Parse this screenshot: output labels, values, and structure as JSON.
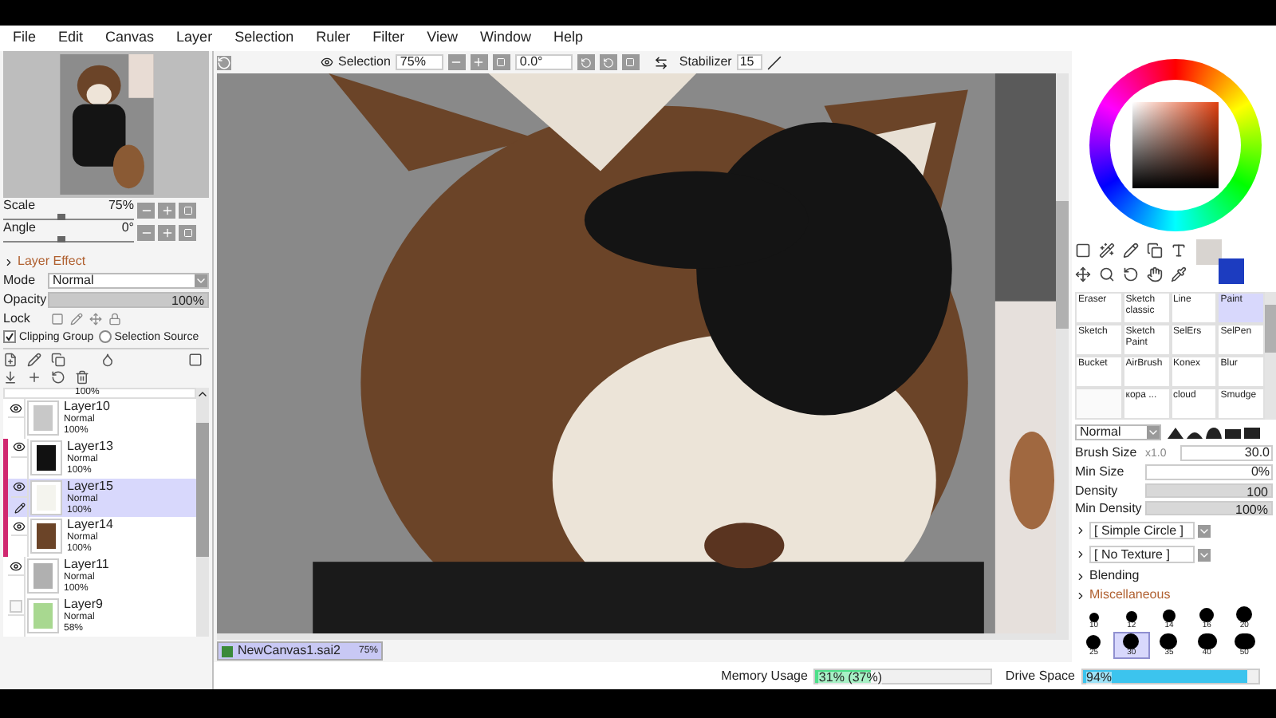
{
  "menu": [
    "File",
    "Edit",
    "Canvas",
    "Layer",
    "Selection",
    "Ruler",
    "Filter",
    "View",
    "Window",
    "Help"
  ],
  "navigator": {
    "scale": {
      "label": "Scale",
      "value": "75%",
      "level": 0.42
    },
    "angle": {
      "label": "Angle",
      "value": "0°",
      "level": 0.42
    }
  },
  "layer_panel": {
    "header": "Layer Effect",
    "mode_label": "Mode",
    "mode": "Normal",
    "opacity": {
      "label": "Opacity",
      "value": "100%",
      "level": 1
    },
    "lock_label": "Lock",
    "clipping_group": {
      "label": "Clipping Group",
      "checked": true
    },
    "selection_source": {
      "label": "Selection Source",
      "selected": false
    },
    "layers": [
      {
        "kind": "partial",
        "opacity": "100%"
      },
      {
        "kind": "layer",
        "name": "Layer10",
        "mode": "Normal",
        "opacity": "100%",
        "visible": true,
        "clipped": false,
        "selected": false,
        "color": "#c8c8c8"
      },
      {
        "kind": "layer",
        "name": "Layer13",
        "mode": "Normal",
        "opacity": "100%",
        "visible": true,
        "clipped": true,
        "selected": false,
        "color": "#111111"
      },
      {
        "kind": "layer",
        "name": "Layer15",
        "mode": "Normal",
        "opacity": "100%",
        "visible": true,
        "clipped": true,
        "selected": true,
        "color": "#f4f4ee"
      },
      {
        "kind": "layer",
        "name": "Layer14",
        "mode": "Normal",
        "opacity": "100%",
        "visible": true,
        "clipped": true,
        "selected": false,
        "color": "#6b4428"
      },
      {
        "kind": "layer",
        "name": "Layer11",
        "mode": "Normal",
        "opacity": "100%",
        "visible": true,
        "clipped": false,
        "selected": false,
        "color": "#b0b0b0"
      },
      {
        "kind": "layer",
        "name": "Layer9",
        "mode": "Normal",
        "opacity": "58%",
        "visible": false,
        "clipped": false,
        "selected": false,
        "color": "#a8d890"
      }
    ]
  },
  "toolbar": {
    "selection_label": "Selection",
    "zoom": "75%",
    "angle": "0.0°",
    "stabilizer_label": "Stabilizer",
    "stabilizer": "15"
  },
  "canvas_tab": {
    "name": "NewCanvas1.sai2",
    "zoom": "75%",
    "selected": true
  },
  "status": [
    {
      "label": "Memory Usage",
      "value": "31% (37%)",
      "level": 0.31,
      "color": "#4ee08a"
    },
    {
      "label": "Drive Space",
      "value": "94%",
      "level": 0.94,
      "color": "#3cc4ee"
    }
  ],
  "swatches": [
    {
      "color": "#d8d4d0"
    },
    {
      "color": "#1c3cc0"
    }
  ],
  "brushes": [
    {
      "kind": "brush",
      "label": "Eraser",
      "selected": false
    },
    {
      "kind": "brush",
      "label": "Sketch classic",
      "selected": false
    },
    {
      "kind": "brush",
      "label": "Line",
      "selected": false
    },
    {
      "kind": "brush",
      "label": "Paint",
      "selected": true
    },
    {
      "kind": "brush",
      "label": "Sketch",
      "selected": false
    },
    {
      "kind": "brush",
      "label": "Sketch Paint",
      "selected": false
    },
    {
      "kind": "brush",
      "label": "SelErs",
      "selected": false
    },
    {
      "kind": "brush",
      "label": "SelPen",
      "selected": false
    },
    {
      "kind": "brush",
      "label": "Bucket",
      "selected": false
    },
    {
      "kind": "brush",
      "label": "AirBrush",
      "selected": false
    },
    {
      "kind": "brush",
      "label": "Konex",
      "selected": false
    },
    {
      "kind": "brush",
      "label": "Blur",
      "selected": false
    },
    {
      "kind": "empty"
    },
    {
      "kind": "brush",
      "label": "кора ...",
      "selected": false
    },
    {
      "kind": "brush",
      "label": "cloud",
      "selected": false
    },
    {
      "kind": "brush",
      "label": "Smudge",
      "selected": false
    }
  ],
  "brush_mode": "Normal",
  "brush_size": {
    "label": "Brush Size",
    "multiplier": "x1.0",
    "value": "30.0"
  },
  "min_size": {
    "label": "Min Size",
    "value": "0%"
  },
  "density": {
    "label": "Density",
    "value": "100",
    "level": 1
  },
  "min_density": {
    "label": "Min Density",
    "value": "100%",
    "level": 1
  },
  "shape": "[ Simple Circle ]",
  "texture": "[ No Texture ]",
  "sections": [
    "Blending",
    "Miscellaneous"
  ],
  "sizes": [
    {
      "label": "10",
      "selected": false
    },
    {
      "label": "12",
      "selected": false
    },
    {
      "label": "14",
      "selected": false
    },
    {
      "label": "16",
      "selected": false
    },
    {
      "label": "20",
      "selected": false
    },
    {
      "label": "25",
      "selected": false
    },
    {
      "label": "30",
      "selected": true
    },
    {
      "label": "35",
      "selected": false
    },
    {
      "label": "40",
      "selected": false
    },
    {
      "label": "50",
      "selected": false
    }
  ]
}
